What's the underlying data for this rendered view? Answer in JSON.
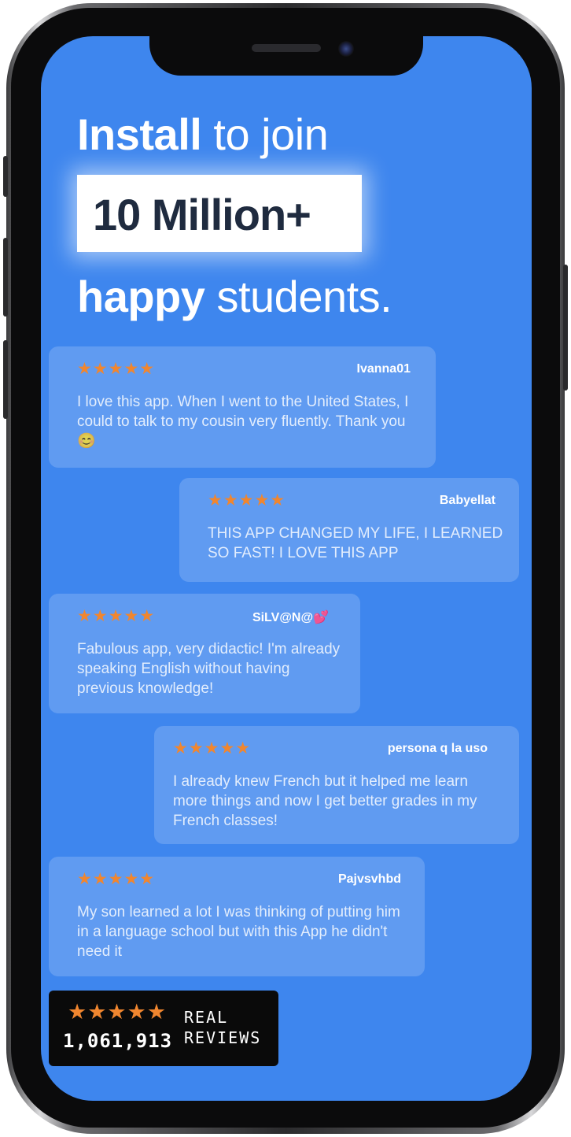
{
  "headline": {
    "line1_bold": "Install",
    "line1_rest": " to join",
    "highlight": "10 Million+",
    "line3_bold": "happy",
    "line3_rest": " students."
  },
  "reviews": [
    {
      "stars": "★★★★★",
      "author": "Ivanna01",
      "text": "I love this app. When I went to the United States, I could to talk to my cousin very fluently. Thank you 😊"
    },
    {
      "stars": "★★★★★",
      "author": "Babyellat",
      "text": "THIS APP CHANGED MY LIFE, I LEARNED SO FAST! I LOVE THIS APP"
    },
    {
      "stars": "★★★★★",
      "author": "SiLV@N@💕",
      "text": "Fabulous app, very didactic! I'm already speaking English without having previous knowledge!"
    },
    {
      "stars": "★★★★★",
      "author": "persona q la uso",
      "text": "I already knew French but it helped me learn more things and now I get better grades in my French classes!"
    },
    {
      "stars": "★★★★★",
      "author": "Pajvsvhbd",
      "text": "My son learned a lot I was thinking of putting him in a language school but with this App he didn't need it"
    }
  ],
  "badge": {
    "stars": "★★★★★",
    "count": "1,061,913",
    "label_line1": "REAL",
    "label_line2": "REVIEWS"
  },
  "colors": {
    "screen_background": "#3e86ee",
    "star_orange": "#f0862f",
    "highlight_text": "#1f2b3f"
  }
}
